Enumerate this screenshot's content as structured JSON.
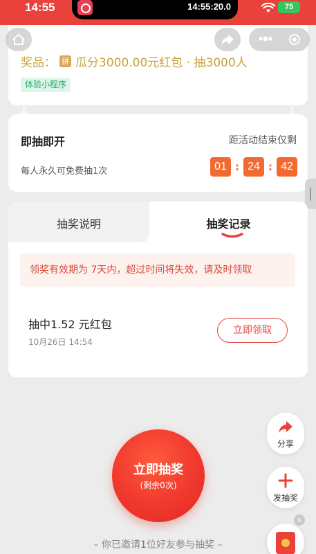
{
  "status_bar": {
    "time": "14:55",
    "island_time": "14:55:20.0",
    "battery": "75"
  },
  "prize": {
    "label": "奖品：",
    "badge": "拼",
    "text": "瓜分3000.00元红包 · 抽3000人",
    "tag": "体验小程序"
  },
  "countdown": {
    "title": "即抽即开",
    "ends_label": "距活动结束仅剩",
    "sub_prefix": "每人永久可免费抽",
    "sub_count": "1",
    "sub_suffix": "次",
    "hours": "01",
    "minutes": "24",
    "seconds": "42",
    "separator": ":"
  },
  "tabs": [
    {
      "label": "抽奖说明",
      "active": false
    },
    {
      "label": "抽奖记录",
      "active": true
    }
  ],
  "notice": "领奖有效期为 7天内，超过时间将失效，请及时领取",
  "record": {
    "title": "抽中1.52 元红包",
    "date": "10月26日 14:54",
    "claim_label": "立即领取"
  },
  "draw": {
    "label": "立即抽奖",
    "sub": "(剩余0次)"
  },
  "invite": {
    "prefix": "– 你已邀请",
    "count": "1",
    "suffix": "位好友参与抽奖 –"
  },
  "floating": {
    "share_label": "分享",
    "post_label": "发抽奖",
    "close": "×"
  },
  "colors": {
    "primary_red": "#e8423b",
    "timer_orange": "#f26a30",
    "prize_gold": "#c9a23a",
    "tag_green": "#21a96a"
  },
  "icons": [
    "home-icon",
    "share-arrow-icon",
    "more-dots-icon",
    "target-icon",
    "plus-icon",
    "red-packet-icon",
    "close-icon",
    "wifi-icon",
    "battery-icon"
  ]
}
